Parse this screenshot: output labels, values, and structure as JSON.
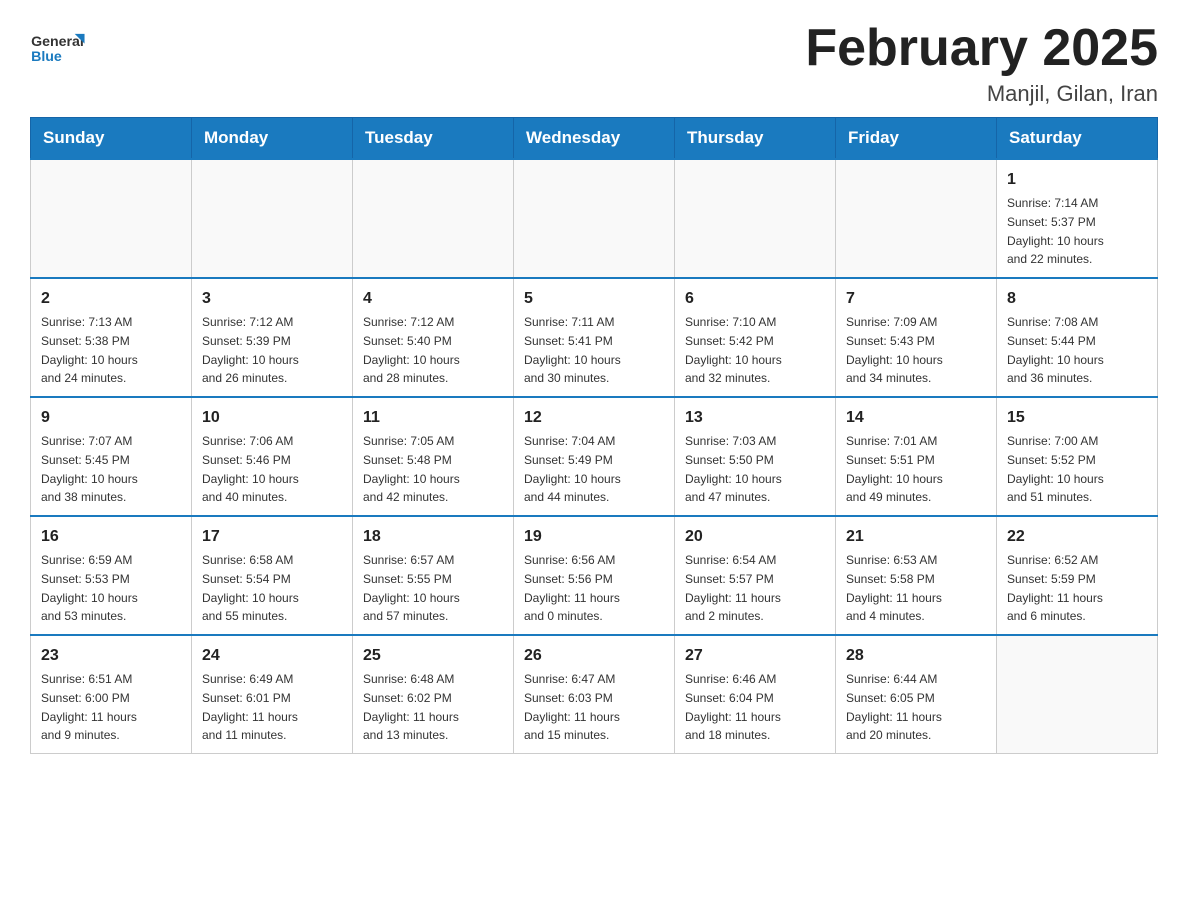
{
  "header": {
    "logo_general": "General",
    "logo_blue": "Blue",
    "month_title": "February 2025",
    "location": "Manjil, Gilan, Iran"
  },
  "weekdays": [
    "Sunday",
    "Monday",
    "Tuesday",
    "Wednesday",
    "Thursday",
    "Friday",
    "Saturday"
  ],
  "weeks": [
    [
      {
        "day": "",
        "info": ""
      },
      {
        "day": "",
        "info": ""
      },
      {
        "day": "",
        "info": ""
      },
      {
        "day": "",
        "info": ""
      },
      {
        "day": "",
        "info": ""
      },
      {
        "day": "",
        "info": ""
      },
      {
        "day": "1",
        "info": "Sunrise: 7:14 AM\nSunset: 5:37 PM\nDaylight: 10 hours\nand 22 minutes."
      }
    ],
    [
      {
        "day": "2",
        "info": "Sunrise: 7:13 AM\nSunset: 5:38 PM\nDaylight: 10 hours\nand 24 minutes."
      },
      {
        "day": "3",
        "info": "Sunrise: 7:12 AM\nSunset: 5:39 PM\nDaylight: 10 hours\nand 26 minutes."
      },
      {
        "day": "4",
        "info": "Sunrise: 7:12 AM\nSunset: 5:40 PM\nDaylight: 10 hours\nand 28 minutes."
      },
      {
        "day": "5",
        "info": "Sunrise: 7:11 AM\nSunset: 5:41 PM\nDaylight: 10 hours\nand 30 minutes."
      },
      {
        "day": "6",
        "info": "Sunrise: 7:10 AM\nSunset: 5:42 PM\nDaylight: 10 hours\nand 32 minutes."
      },
      {
        "day": "7",
        "info": "Sunrise: 7:09 AM\nSunset: 5:43 PM\nDaylight: 10 hours\nand 34 minutes."
      },
      {
        "day": "8",
        "info": "Sunrise: 7:08 AM\nSunset: 5:44 PM\nDaylight: 10 hours\nand 36 minutes."
      }
    ],
    [
      {
        "day": "9",
        "info": "Sunrise: 7:07 AM\nSunset: 5:45 PM\nDaylight: 10 hours\nand 38 minutes."
      },
      {
        "day": "10",
        "info": "Sunrise: 7:06 AM\nSunset: 5:46 PM\nDaylight: 10 hours\nand 40 minutes."
      },
      {
        "day": "11",
        "info": "Sunrise: 7:05 AM\nSunset: 5:48 PM\nDaylight: 10 hours\nand 42 minutes."
      },
      {
        "day": "12",
        "info": "Sunrise: 7:04 AM\nSunset: 5:49 PM\nDaylight: 10 hours\nand 44 minutes."
      },
      {
        "day": "13",
        "info": "Sunrise: 7:03 AM\nSunset: 5:50 PM\nDaylight: 10 hours\nand 47 minutes."
      },
      {
        "day": "14",
        "info": "Sunrise: 7:01 AM\nSunset: 5:51 PM\nDaylight: 10 hours\nand 49 minutes."
      },
      {
        "day": "15",
        "info": "Sunrise: 7:00 AM\nSunset: 5:52 PM\nDaylight: 10 hours\nand 51 minutes."
      }
    ],
    [
      {
        "day": "16",
        "info": "Sunrise: 6:59 AM\nSunset: 5:53 PM\nDaylight: 10 hours\nand 53 minutes."
      },
      {
        "day": "17",
        "info": "Sunrise: 6:58 AM\nSunset: 5:54 PM\nDaylight: 10 hours\nand 55 minutes."
      },
      {
        "day": "18",
        "info": "Sunrise: 6:57 AM\nSunset: 5:55 PM\nDaylight: 10 hours\nand 57 minutes."
      },
      {
        "day": "19",
        "info": "Sunrise: 6:56 AM\nSunset: 5:56 PM\nDaylight: 11 hours\nand 0 minutes."
      },
      {
        "day": "20",
        "info": "Sunrise: 6:54 AM\nSunset: 5:57 PM\nDaylight: 11 hours\nand 2 minutes."
      },
      {
        "day": "21",
        "info": "Sunrise: 6:53 AM\nSunset: 5:58 PM\nDaylight: 11 hours\nand 4 minutes."
      },
      {
        "day": "22",
        "info": "Sunrise: 6:52 AM\nSunset: 5:59 PM\nDaylight: 11 hours\nand 6 minutes."
      }
    ],
    [
      {
        "day": "23",
        "info": "Sunrise: 6:51 AM\nSunset: 6:00 PM\nDaylight: 11 hours\nand 9 minutes."
      },
      {
        "day": "24",
        "info": "Sunrise: 6:49 AM\nSunset: 6:01 PM\nDaylight: 11 hours\nand 11 minutes."
      },
      {
        "day": "25",
        "info": "Sunrise: 6:48 AM\nSunset: 6:02 PM\nDaylight: 11 hours\nand 13 minutes."
      },
      {
        "day": "26",
        "info": "Sunrise: 6:47 AM\nSunset: 6:03 PM\nDaylight: 11 hours\nand 15 minutes."
      },
      {
        "day": "27",
        "info": "Sunrise: 6:46 AM\nSunset: 6:04 PM\nDaylight: 11 hours\nand 18 minutes."
      },
      {
        "day": "28",
        "info": "Sunrise: 6:44 AM\nSunset: 6:05 PM\nDaylight: 11 hours\nand 20 minutes."
      },
      {
        "day": "",
        "info": ""
      }
    ]
  ]
}
